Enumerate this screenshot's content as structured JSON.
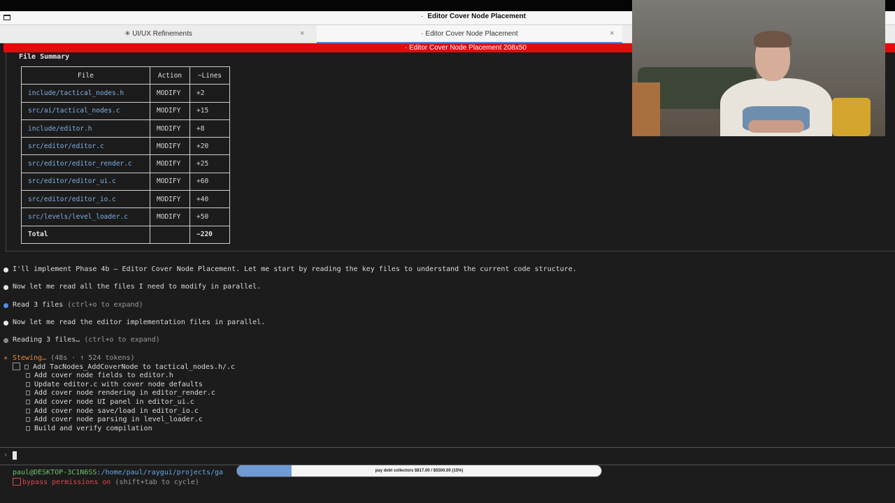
{
  "window": {
    "title_dot": "·",
    "title": "Editor Cover Node Placement"
  },
  "tabs": [
    {
      "label": "✳ UI/UX Refinements",
      "close": "×"
    },
    {
      "label": "· Editor Cover Node Placement",
      "close": "×"
    }
  ],
  "terminal_title": "· Editor Cover Node Placement 208x50",
  "file_summary": {
    "title": "File Summary",
    "headers": [
      "File",
      "Action",
      "~Lines"
    ],
    "rows": [
      {
        "file": "include/tactical_nodes.h",
        "action": "MODIFY",
        "lines": "+2"
      },
      {
        "file": "src/ai/tactical_nodes.c",
        "action": "MODIFY",
        "lines": "+15"
      },
      {
        "file": "include/editor.h",
        "action": "MODIFY",
        "lines": "+8"
      },
      {
        "file": "src/editor/editor.c",
        "action": "MODIFY",
        "lines": "+20"
      },
      {
        "file": "src/editor/editor_render.c",
        "action": "MODIFY",
        "lines": "+25"
      },
      {
        "file": "src/editor/editor_ui.c",
        "action": "MODIFY",
        "lines": "+60"
      },
      {
        "file": "src/editor/editor_io.c",
        "action": "MODIFY",
        "lines": "+40"
      },
      {
        "file": "src/levels/level_loader.c",
        "action": "MODIFY",
        "lines": "+50"
      }
    ],
    "total_label": "Total",
    "total_lines": "~220"
  },
  "messages": {
    "m1": "I'll implement Phase 4b — Editor Cover Node Placement. Let me start by reading the key files to understand the current code structure.",
    "m2": "Now let me read all the files I need to modify in parallel.",
    "m3": "Read 3 files",
    "m3_hint": "(ctrl+o to expand)",
    "m4": "Now let me read the editor implementation files in parallel.",
    "m5": "Reading 3 files…",
    "m5_hint": "(ctrl+o to expand)"
  },
  "status_activity": {
    "star": "✳",
    "label": "Stewing…",
    "meta": "(48s · ↑ 524 tokens)"
  },
  "todos": [
    "□ Add TacNodes_AddCoverNode to tactical_nodes.h/.c",
    "□ Add cover node fields to editor.h",
    "□ Update editor.c with cover node defaults",
    "□ Add cover node rendering in editor_render.c",
    "□ Add cover node UI panel in editor_ui.c",
    "□ Add cover node save/load in editor_io.c",
    "□ Add cover node parsing in level_loader.c",
    "□ Build and verify compilation"
  ],
  "prompt": {
    "caret": "›"
  },
  "statusline": {
    "user": "paul@DESKTOP-3C1N6SS",
    "path": ":/home/paul/raygui/projects/ga",
    "permissions": "bypass permissions on",
    "permissions_hint": "(shift+tab to cycle)"
  },
  "overlay_progress": {
    "label": "pay debt collectors $817.00 / $5500.00 (15%)",
    "fraction": 0.15
  },
  "colors": {
    "accent_red": "#e00d0d",
    "file_blue": "#7fb2e6",
    "activity_orange": "#e88b3a",
    "user_green": "#6cc46c"
  }
}
